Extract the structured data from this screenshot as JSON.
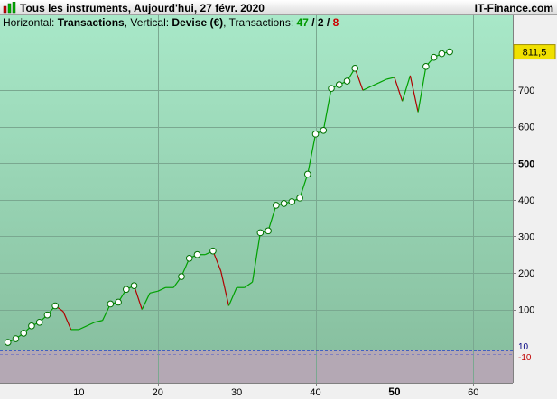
{
  "window": {
    "title": "Tous les instruments, Aujourd'hui, 27 févr. 2020",
    "brand": "IT-Finance.com"
  },
  "info": {
    "horizontal_label": "Horizontal: ",
    "horizontal_value": "Transactions",
    "vertical_label": ", Vertical: ",
    "vertical_value": "Devise (€)",
    "transactions_label": ", Transactions: ",
    "count_wins": "47",
    "sep1": " / ",
    "count_flat": "2",
    "sep2": " / ",
    "count_losses": "8"
  },
  "colors": {
    "bg_top": "#a8e8c8",
    "bg_bottom": "#8ac4a0",
    "sub_bg": "#b4a8b4",
    "up": "#00a000",
    "down": "#b00000",
    "marker_fill": "#ffffff",
    "marker_stroke": "#007000",
    "last_badge": "#f0e000"
  },
  "chart_data": {
    "type": "line",
    "title": "",
    "xlabel": "Transactions",
    "ylabel": "Devise (€)",
    "xlim": [
      0,
      65
    ],
    "ylim": [
      -12,
      905
    ],
    "x_ticks": [
      10,
      20,
      30,
      40,
      50,
      60
    ],
    "x_tick_labels": [
      "10",
      "20",
      "30",
      "40",
      "50",
      "60"
    ],
    "x_tick_bold": "50",
    "y_ticks": [
      100,
      200,
      300,
      400,
      500,
      600,
      700
    ],
    "y_tick_labels": [
      "100",
      "200",
      "300",
      "400",
      "500",
      "600",
      "700"
    ],
    "y_tick_bold": "500",
    "last_value_label": "811,5",
    "sub_pane_labels": [
      "10",
      "-10"
    ],
    "grid": true,
    "x": [
      1,
      2,
      3,
      4,
      5,
      6,
      7,
      8,
      9,
      10,
      11,
      12,
      13,
      14,
      15,
      16,
      17,
      18,
      19,
      20,
      21,
      22,
      23,
      24,
      25,
      26,
      27,
      28,
      29,
      30,
      31,
      32,
      33,
      34,
      35,
      36,
      37,
      38,
      39,
      40,
      41,
      42,
      43,
      44,
      45,
      46,
      47,
      48,
      49,
      50,
      51,
      52,
      53,
      54,
      55,
      56,
      57
    ],
    "y": [
      10,
      20,
      35,
      55,
      65,
      85,
      110,
      95,
      45,
      45,
      55,
      65,
      70,
      115,
      120,
      155,
      165,
      100,
      145,
      150,
      160,
      160,
      190,
      240,
      250,
      250,
      260,
      205,
      110,
      160,
      160,
      175,
      310,
      315,
      385,
      390,
      395,
      405,
      470,
      580,
      590,
      705,
      715,
      725,
      760,
      700,
      710,
      720,
      730,
      735,
      670,
      740,
      640,
      765,
      790,
      800,
      805
    ],
    "marker_indices": [
      0,
      1,
      2,
      3,
      4,
      5,
      6,
      13,
      14,
      15,
      16,
      22,
      23,
      24,
      26,
      32,
      33,
      34,
      35,
      36,
      37,
      38,
      39,
      40,
      41,
      42,
      43,
      44,
      53,
      54,
      55,
      56
    ]
  }
}
